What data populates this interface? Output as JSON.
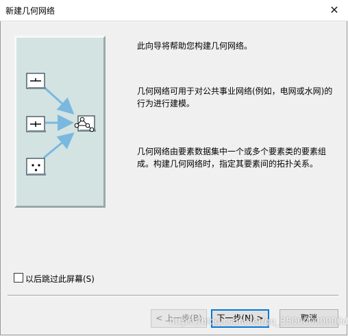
{
  "window": {
    "title": "新建几何网络"
  },
  "content": {
    "intro": "此向导将帮助您构建几何网络。",
    "para1": "几何网络可用于对公共事业网络(例如，电网或水网)的行为进行建模。",
    "para2": "几何网络由要素数据集中一个或多个要素类的要素组成。构建几何网络时，指定其要素间的拓扑关系。"
  },
  "skip_checkbox": {
    "label": "以后跳过此屏幕(S)",
    "checked": false
  },
  "buttons": {
    "back": "< 上一步(B)",
    "next": "下一步(N) >",
    "cancel": "取消"
  },
  "watermark": "https://blog.csdn.net/qq_35000000000d",
  "colors": {
    "panel": "#d3e3e1",
    "accent": "#0078d7",
    "arrow": "#7ab8e0"
  },
  "icons": [
    "line-feature-icon",
    "line-feature-icon",
    "point-feature-icon",
    "network-node-icon",
    "arrow-icon"
  ]
}
